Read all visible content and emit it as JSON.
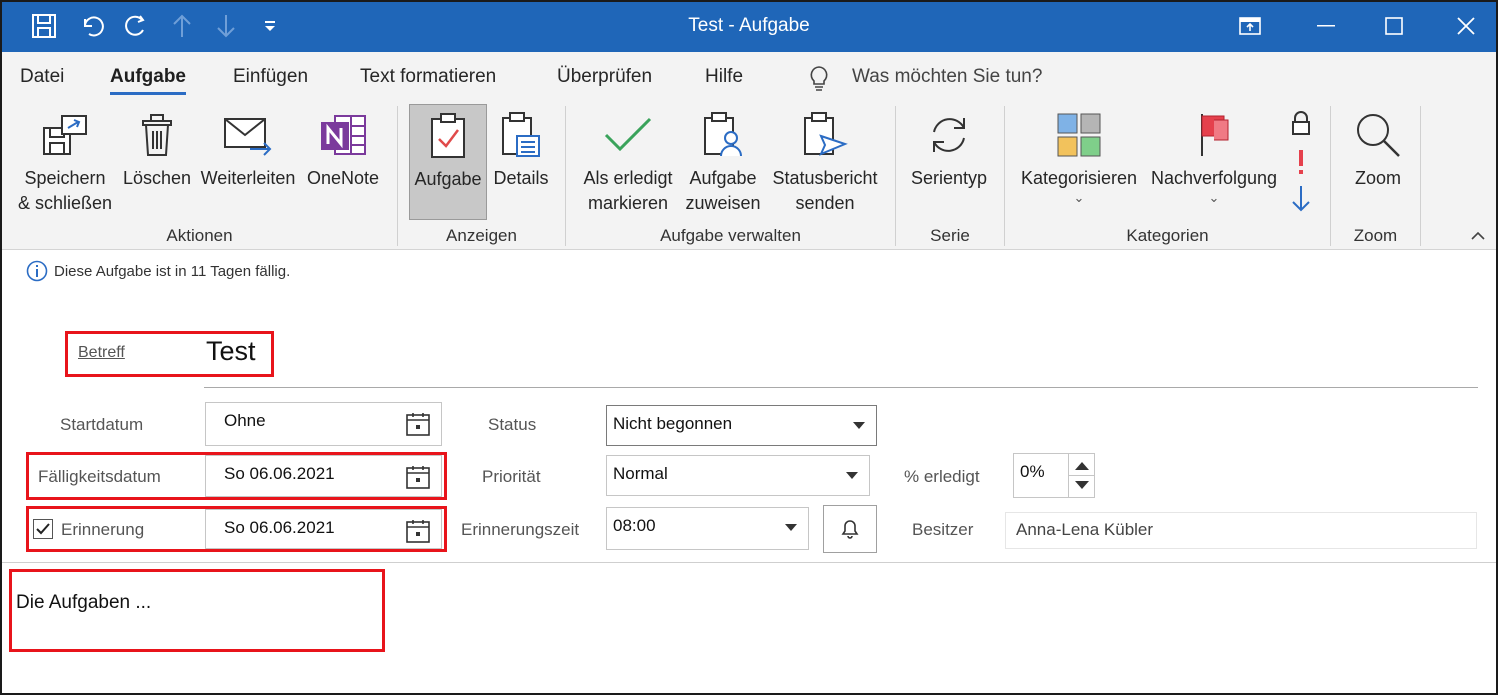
{
  "window": {
    "title": "Test  -  Aufgabe"
  },
  "tabs": [
    "Datei",
    "Aufgabe",
    "Einfügen",
    "Text formatieren",
    "Überprüfen",
    "Hilfe"
  ],
  "tell_me": "Was möchten Sie tun?",
  "ribbon": {
    "groups": {
      "aktionen": "Aktionen",
      "anzeigen": "Anzeigen",
      "verwalten": "Aufgabe verwalten",
      "serie": "Serie",
      "kategorien": "Kategorien",
      "zoom": "Zoom"
    },
    "buttons": {
      "save_l1": "Speichern",
      "save_l2": "& schließen",
      "delete": "Löschen",
      "forward": "Weiterleiten",
      "onenote": "OneNote",
      "task": "Aufgabe",
      "details": "Details",
      "done_l1": "Als erledigt",
      "done_l2": "markieren",
      "assign_l1": "Aufgabe",
      "assign_l2": "zuweisen",
      "status_l1": "Statusbericht",
      "status_l2": "senden",
      "recurrence": "Serientyp",
      "categorize": "Kategorisieren",
      "followup": "Nachverfolgung",
      "zoom": "Zoom"
    }
  },
  "info": "Diese Aufgabe ist in 11 Tagen fällig.",
  "form": {
    "subject_label": "Betreff",
    "subject_value": "Test",
    "start_label": "Startdatum",
    "start_value": "Ohne",
    "due_label": "Fälligkeitsdatum",
    "due_value": "So 06.06.2021",
    "reminder_label": "Erinnerung",
    "reminder_checked": true,
    "reminder_value": "So 06.06.2021",
    "status_label": "Status",
    "status_value": "Nicht begonnen",
    "priority_label": "Priorität",
    "priority_value": "Normal",
    "percent_label": "% erledigt",
    "percent_value": "0%",
    "reminder_time_label": "Erinnerungszeit",
    "reminder_time_value": "08:00",
    "owner_label": "Besitzer",
    "owner_value": "Anna-Lena Kübler"
  },
  "body_text": "Die Aufgaben ...",
  "colors": {
    "titlebar": "#1f66b8",
    "ribbon": "#f3f3f3",
    "highlight": "#e8141b",
    "accent": "#2b6cc4"
  }
}
